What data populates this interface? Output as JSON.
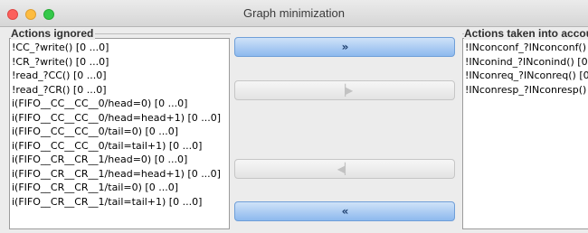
{
  "window": {
    "title": "Graph minimization"
  },
  "left_panel": {
    "title": "Actions ignored",
    "items": [
      "!CC_?write() [0 ...0]",
      "!CR_?write() [0 ...0]",
      "!read_?CC() [0 ...0]",
      "!read_?CR() [0 ...0]",
      "i(FIFO__CC__CC__0/head=0) [0 ...0]",
      "i(FIFO__CC__CC__0/head=head+1) [0 ...0]",
      "i(FIFO__CC__CC__0/tail=0) [0 ...0]",
      "i(FIFO__CC__CC__0/tail=tail+1) [0 ...0]",
      "i(FIFO__CR__CR__1/head=0) [0 ...0]",
      "i(FIFO__CR__CR__1/head=head+1) [0 ...0]",
      "i(FIFO__CR__CR__1/tail=0) [0 ...0]",
      "i(FIFO__CR__CR__1/tail=tail+1) [0 ...0]"
    ]
  },
  "right_panel": {
    "title": "Actions taken into accoun",
    "items": [
      "!INconconf_?INconconf() [0",
      "!INconind_?INconind() [0 ...",
      "!INconreq_?INconreq() [0 ...",
      "!INconresp_?INconresp() [0"
    ]
  },
  "buttons": {
    "move_all_right": {
      "glyph": "»",
      "enabled": true
    },
    "move_right": {
      "glyph": "▕▶",
      "enabled": false
    },
    "move_left": {
      "glyph": "◀▏",
      "enabled": false
    },
    "move_all_left": {
      "glyph": "«",
      "enabled": true
    }
  },
  "colors": {
    "button_enabled": "#8db9ee",
    "close": "#fc605c",
    "minimize": "#fdbc40",
    "maximize": "#34c84a"
  }
}
